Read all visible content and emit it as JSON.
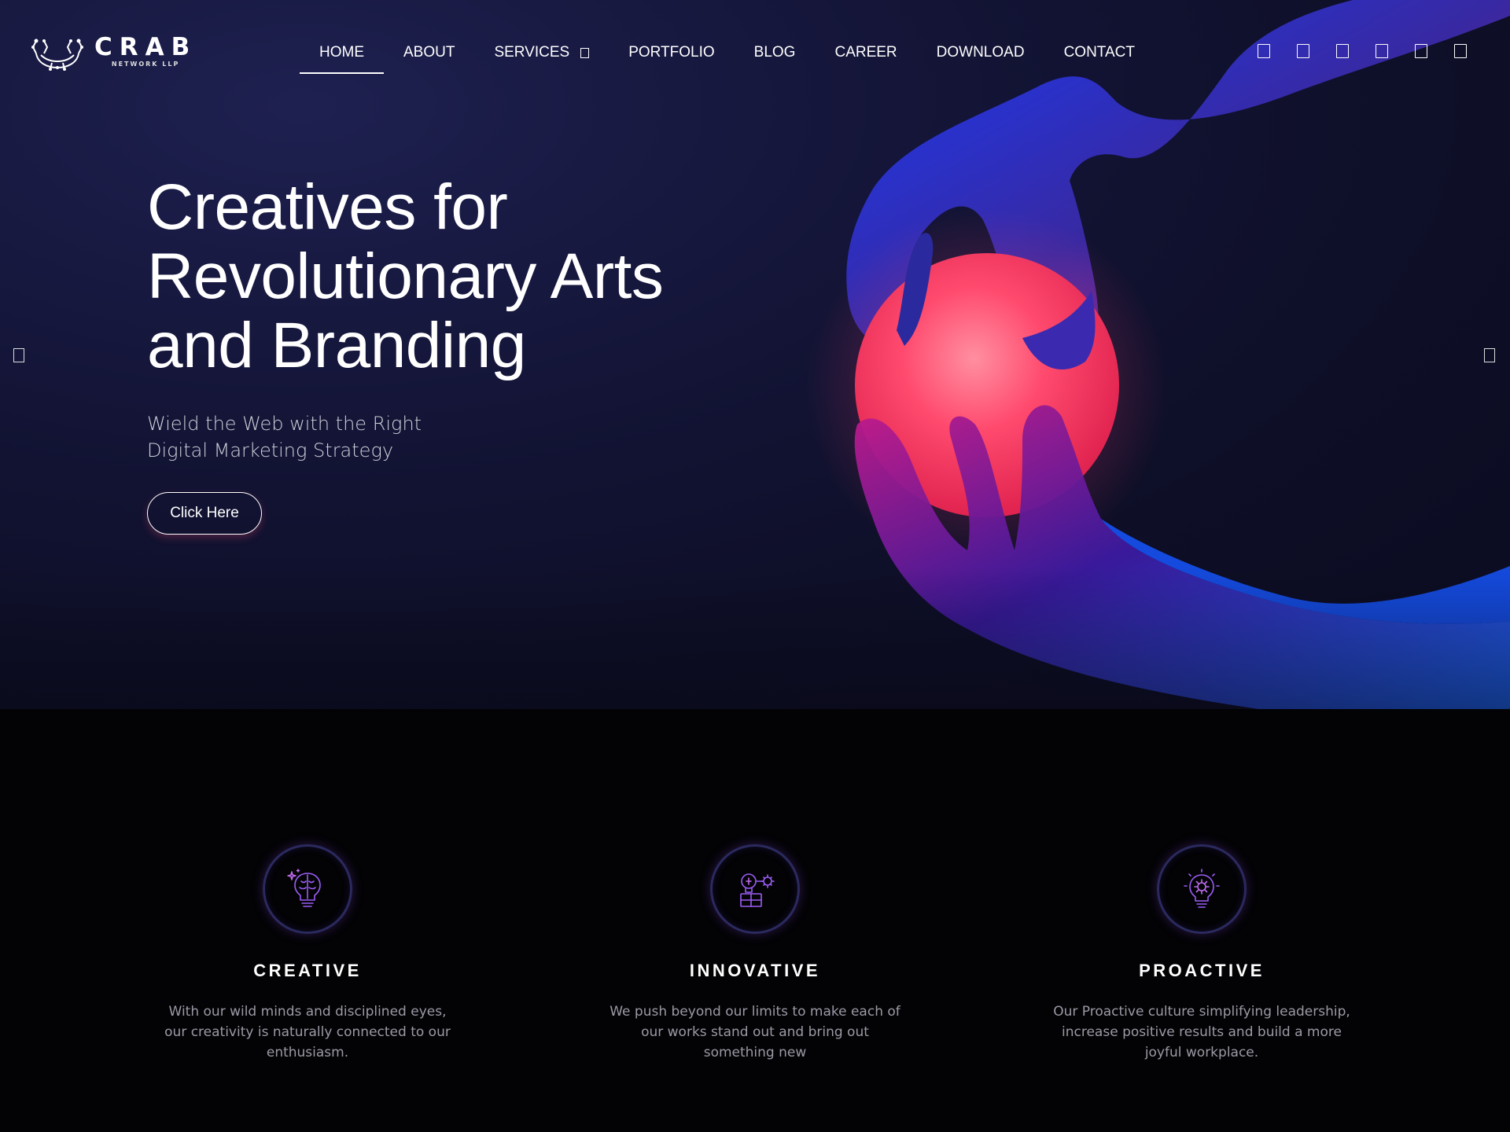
{
  "brand": {
    "name": "CRAB",
    "sub": "NETWORK LLP"
  },
  "nav": {
    "items": [
      {
        "label": "HOME",
        "active": true
      },
      {
        "label": "ABOUT"
      },
      {
        "label": "SERVICES",
        "has_dropdown": true
      },
      {
        "label": "PORTFOLIO"
      },
      {
        "label": "BLOG"
      },
      {
        "label": "CAREER"
      },
      {
        "label": "DOWNLOAD"
      },
      {
        "label": "CONTACT"
      }
    ]
  },
  "socials": [
    "social-icon-1",
    "social-icon-2",
    "social-icon-3",
    "social-icon-4",
    "social-icon-5",
    "social-icon-6"
  ],
  "hero": {
    "title": "Creatives for Revolutionary Arts and Branding",
    "subtitle": "Wield the Web with the Right Digital Marketing Strategy",
    "cta": "Click Here"
  },
  "features": [
    {
      "icon": "brain-bulb-icon",
      "title": "CREATIVE",
      "text": "With our wild minds and disciplined eyes, our creativity is naturally connected to our enthusiasm."
    },
    {
      "icon": "innovation-bulb-gear-icon",
      "title": "INNOVATIVE",
      "text": "We push beyond our limits to make each of our works stand out and bring out something new"
    },
    {
      "icon": "gear-bulb-icon",
      "title": "PROACTIVE",
      "text": "Our Proactive culture simplifying leadership, increase positive results and build a more joyful workplace."
    }
  ],
  "colors": {
    "hero_bg": "#141538",
    "accent_pink": "#ff3d6e",
    "accent_blue": "#1a5cff",
    "icon_stroke": "#8a5cf6"
  }
}
